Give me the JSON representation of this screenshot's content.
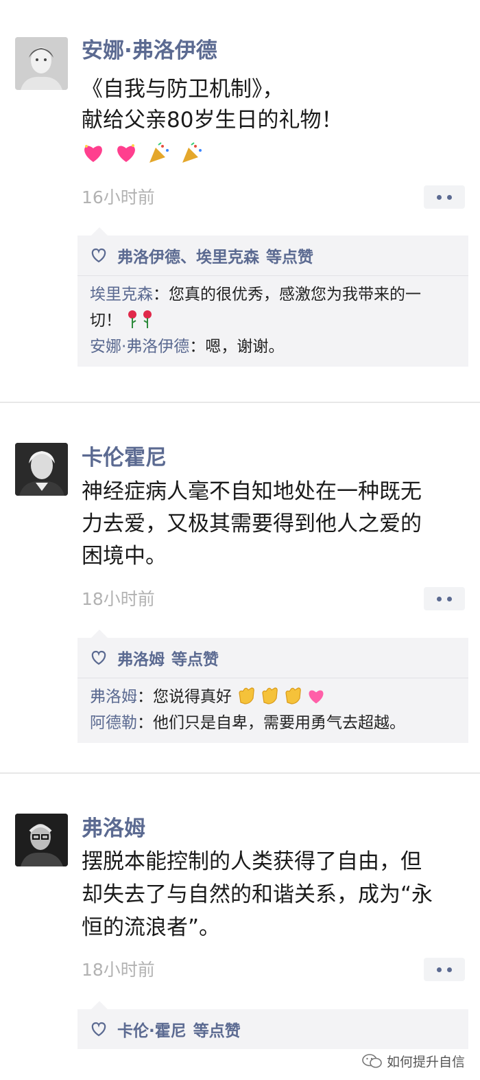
{
  "posts": [
    {
      "author": "安娜·弗洛伊德",
      "lines": [
        "《自我与防卫机制》，",
        "献给父亲80岁生日的礼物！"
      ],
      "emojis": [
        "sparkling-heart",
        "sparkling-heart",
        "party-popper",
        "party-popper"
      ],
      "time": "16小时前",
      "likes": {
        "names": "弗洛伊德、埃里克森",
        "suffix": "等点赞"
      },
      "comments": [
        {
          "author": "埃里克森",
          "sep": "：",
          "lines": [
            "您真的很优秀，感激您为我带来的一",
            "切！"
          ],
          "emojis": [
            "rose",
            "rose"
          ]
        },
        {
          "author": "安娜·弗洛伊德",
          "sep": "：",
          "lines": [
            "嗯，谢谢。"
          ]
        }
      ]
    },
    {
      "author": "卡伦霍尼",
      "lines": [
        "神经症病人毫不自知地处在一种既无",
        "力去爱，又极其需要得到他人之爱的",
        "困境中。"
      ],
      "time": "18小时前",
      "likes": {
        "names": "弗洛姆",
        "suffix": "等点赞"
      },
      "comments": [
        {
          "author": "弗洛姆",
          "sep": "：",
          "lines": [
            "您说得真好"
          ],
          "emojis": [
            "clap",
            "clap",
            "clap",
            "pink-heart"
          ]
        },
        {
          "author": "阿德勒",
          "sep": "：",
          "lines": [
            "他们只是自卑，需要用勇气去超越。"
          ]
        }
      ]
    },
    {
      "author": "弗洛姆",
      "lines": [
        "摆脱本能控制的人类获得了自由，但",
        "却失去了与自然的和谐关系，成为“永",
        "恒的流浪者”。"
      ],
      "time": "18小时前",
      "likes": {
        "names": "卡伦·霍尼",
        "suffix": "等点赞"
      }
    }
  ],
  "watermark": {
    "text": "如何提升自信",
    "icon": "wechat-icon"
  },
  "colors": {
    "link": "#5b6a91",
    "text": "#1a1a1a",
    "time": "#b2b2b2",
    "panel": "#f3f3f5"
  }
}
